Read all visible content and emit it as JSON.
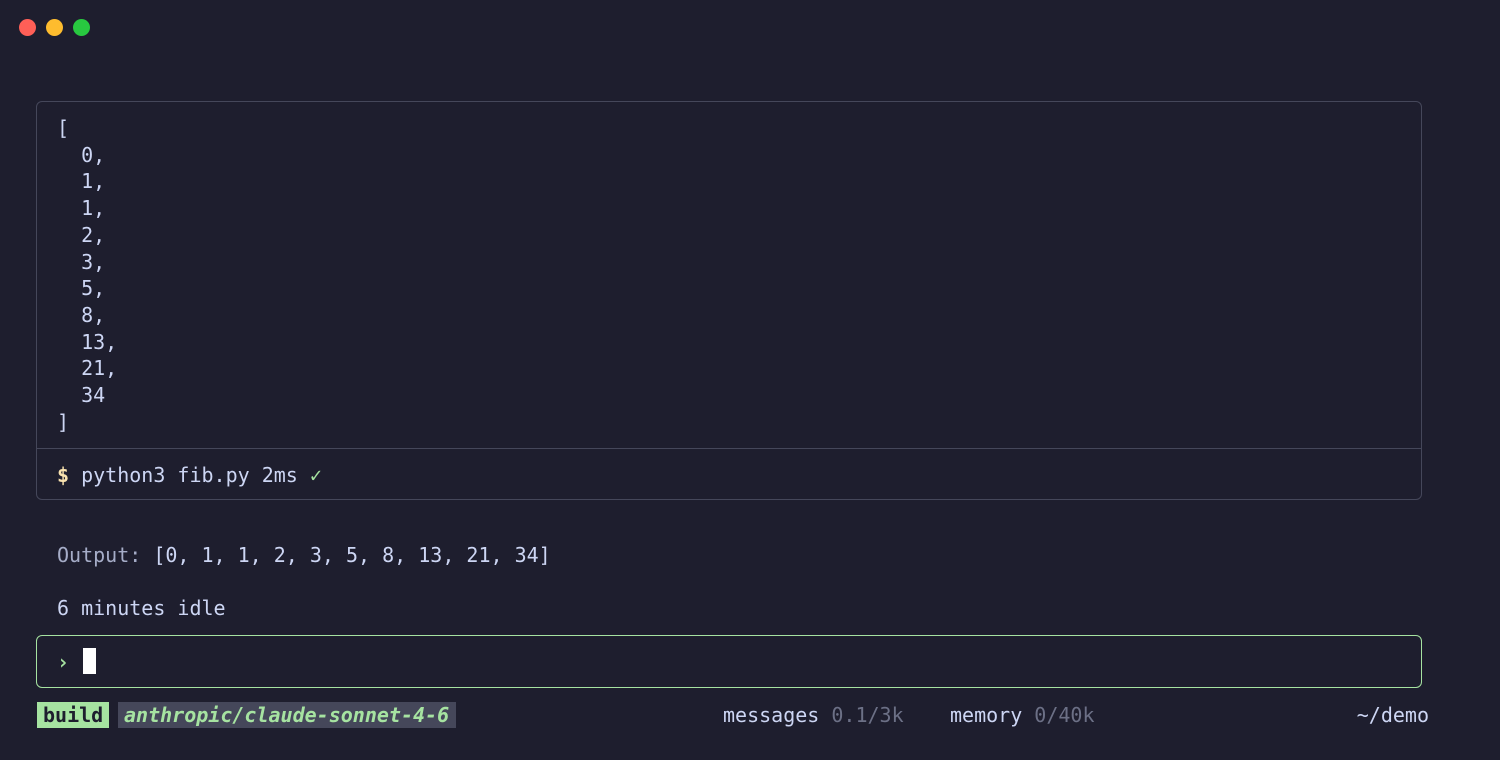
{
  "window": {
    "controls": [
      "close",
      "minimize",
      "maximize"
    ]
  },
  "tool_output": {
    "lines": [
      "[",
      "  0,",
      "  1,",
      "  1,",
      "  2,",
      "  3,",
      "  5,",
      "  8,",
      "  13,",
      "  21,",
      "  34",
      "]"
    ],
    "command": {
      "prompt_symbol": "$",
      "text": "python3 fib.py",
      "duration": "2ms",
      "status_icon": "✓"
    }
  },
  "assistant": {
    "output_label": "Output:",
    "output_value": "[0, 1, 1, 2, 3, 5, 8, 13, 21, 34]"
  },
  "idle_status": "6 minutes idle",
  "input": {
    "prompt_symbol": "›",
    "value": ""
  },
  "status_bar": {
    "mode": "build",
    "model": "anthropic/claude-sonnet-4-6",
    "messages_label": "messages",
    "messages_value": "0.1/3k",
    "memory_label": "memory",
    "memory_value": "0/40k",
    "cwd": "~/demo"
  },
  "colors": {
    "background": "#1e1e2e",
    "accent_green": "#a6e3a1",
    "prompt_yellow": "#f9e2af",
    "border": "#45475a",
    "muted_text": "#6c7086"
  }
}
